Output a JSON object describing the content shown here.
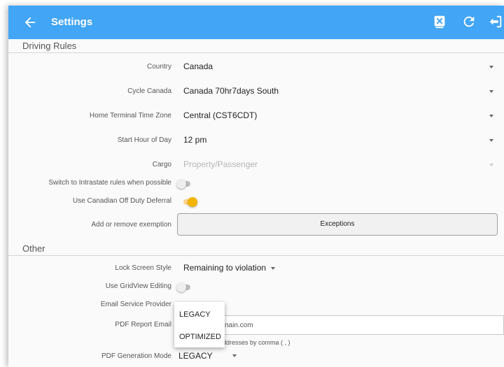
{
  "appbar": {
    "title": "Settings"
  },
  "sections": {
    "driving_rules": "Driving Rules",
    "other": "Other"
  },
  "driving_rules": {
    "country": {
      "label": "Country",
      "value": "Canada"
    },
    "cycle": {
      "label": "Cycle Canada",
      "value": "Canada 70hr7days South"
    },
    "time_zone": {
      "label": "Home Terminal Time Zone",
      "value": "Central (CST6CDT)"
    },
    "start_hour": {
      "label": "Start Hour of Day",
      "value": "12 pm"
    },
    "cargo": {
      "label": "Cargo",
      "value": "Property/Passenger"
    },
    "intrastate": {
      "label": "Switch to Intrastate rules when possible",
      "on": false
    },
    "off_duty_deferral": {
      "label": "Use Canadian Off Duty Deferral",
      "on": true
    },
    "exemption": {
      "label": "Add or remove exemption",
      "button": "Exceptions"
    }
  },
  "other": {
    "lock_screen": {
      "label": "Lock Screen Style",
      "value": "Remaining to violation"
    },
    "gridview": {
      "label": "Use GridView Editing",
      "on": false
    },
    "email_provider": {
      "label": "Email Service Provider"
    },
    "pdf_email": {
      "label": "PDF Report Email",
      "value_visible": "nain.com",
      "hint_visible": "ddresses by comma ( , )"
    },
    "pdf_mode": {
      "label": "PDF Generation Mode",
      "value": "LEGACY"
    }
  },
  "dropdown_popup": {
    "options": [
      "LEGACY",
      "OPTIMIZED"
    ]
  },
  "colors": {
    "appbar": "#42a5f5",
    "toggle_on": "#f4b400"
  }
}
